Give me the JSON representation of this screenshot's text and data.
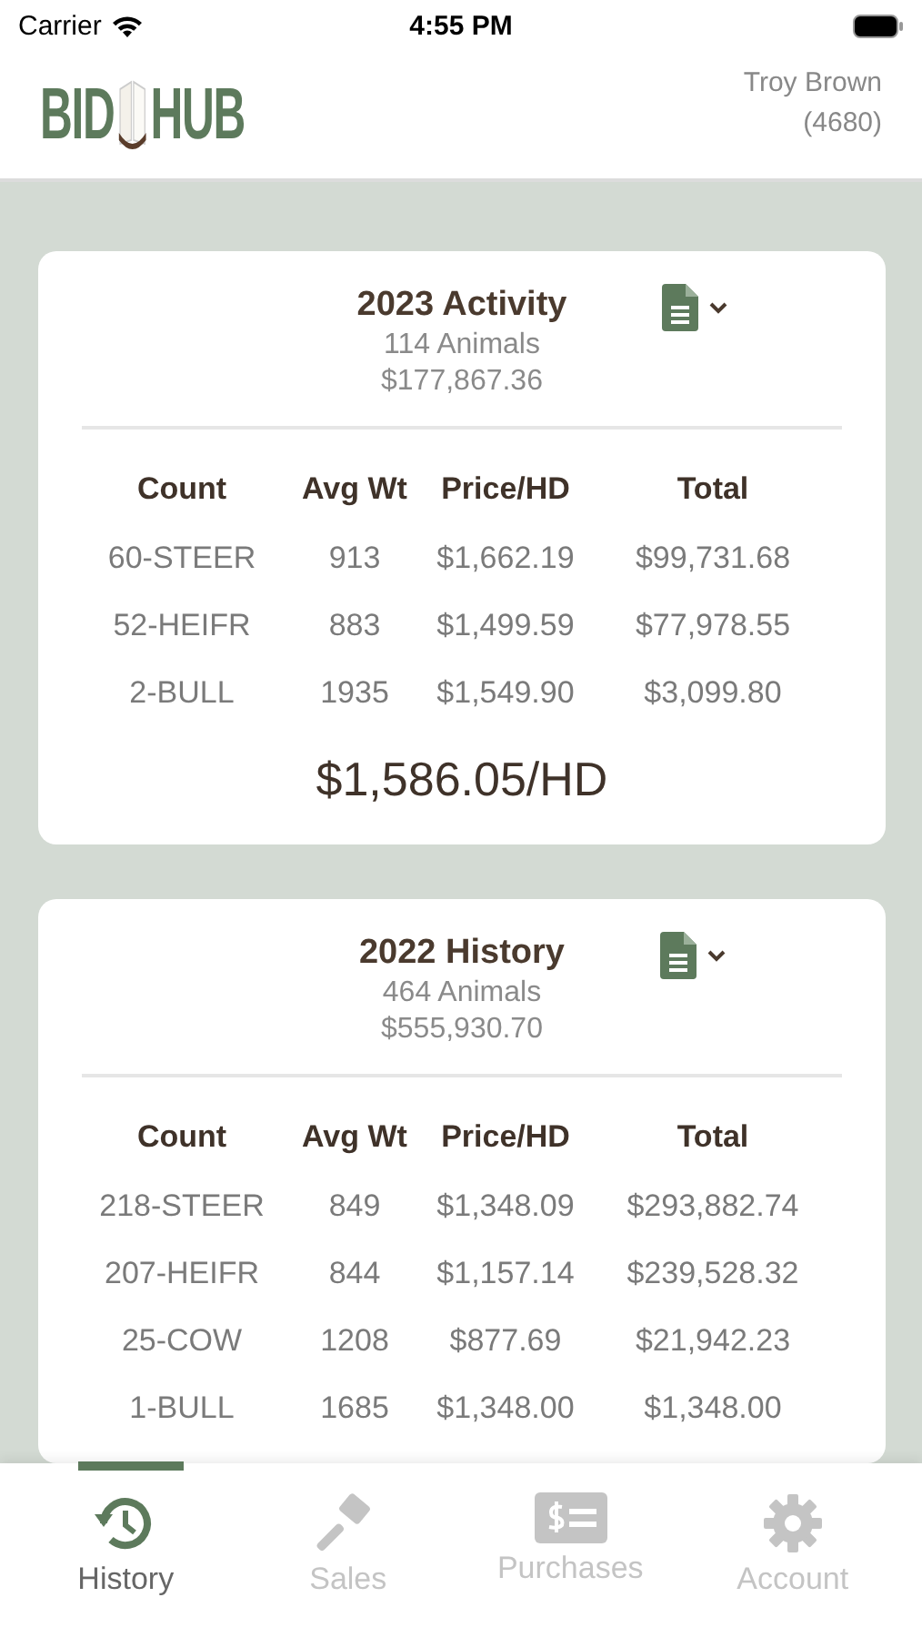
{
  "status_bar": {
    "carrier": "Carrier",
    "time": "4:55 PM"
  },
  "header": {
    "logo": {
      "left": "BID",
      "right": "HUB"
    },
    "user_name": "Troy Brown",
    "user_id": "(4680)"
  },
  "cards": [
    {
      "title": "2023 Activity",
      "animals": "114 Animals",
      "amount": "$177,867.36",
      "columns": [
        "Count",
        "Avg Wt",
        "Price/HD",
        "Total"
      ],
      "rows": [
        [
          "60-STEER",
          "913",
          "$1,662.19",
          "$99,731.68"
        ],
        [
          "52-HEIFR",
          "883",
          "$1,499.59",
          "$77,978.55"
        ],
        [
          "2-BULL",
          "1935",
          "$1,549.90",
          "$3,099.80"
        ]
      ],
      "average": "$1,586.05/HD"
    },
    {
      "title": "2022 History",
      "animals": "464 Animals",
      "amount": "$555,930.70",
      "columns": [
        "Count",
        "Avg Wt",
        "Price/HD",
        "Total"
      ],
      "rows": [
        [
          "218-STEER",
          "849",
          "$1,348.09",
          "$293,882.74"
        ],
        [
          "207-HEIFR",
          "844",
          "$1,157.14",
          "$239,528.32"
        ],
        [
          "25-COW",
          "1208",
          "$877.69",
          "$21,942.23"
        ],
        [
          "1-BULL",
          "1685",
          "$1,348.00",
          "$1,348.00"
        ]
      ]
    }
  ],
  "tabs": [
    {
      "kind": "history",
      "label": "History",
      "selected": true
    },
    {
      "kind": "sales",
      "label": "Sales",
      "selected": false
    },
    {
      "kind": "purchases",
      "label": "Purchases",
      "selected": false
    },
    {
      "kind": "account",
      "label": "Account",
      "selected": false
    }
  ]
}
